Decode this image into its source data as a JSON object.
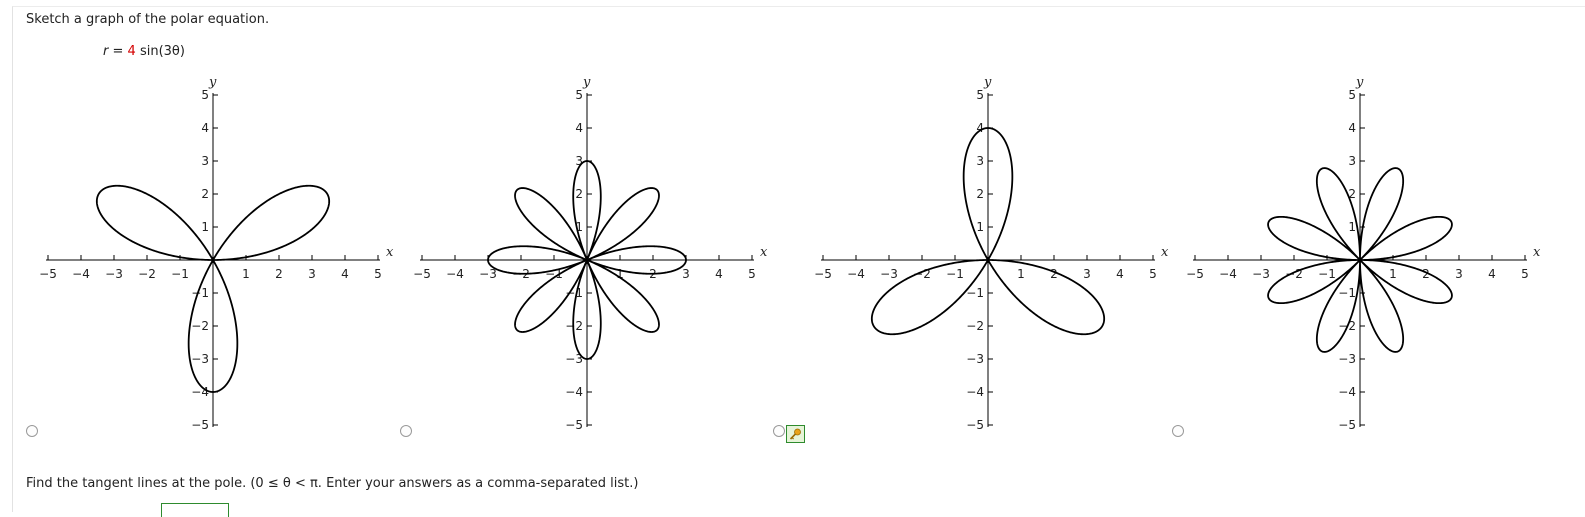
{
  "question": {
    "prompt": "Sketch a graph of the polar equation.",
    "equation": {
      "lhs": "r",
      "eq": " = ",
      "coef": "4",
      "rest": " sin(3θ)"
    },
    "coef_color": "#d40000"
  },
  "answer_options": [
    {
      "option": "A",
      "petals": 3,
      "amplitude": 4,
      "rotation": 0,
      "selected": false
    },
    {
      "option": "B",
      "petals": 8,
      "amplitude": 3,
      "rotation": 0,
      "selected": false
    },
    {
      "option": "C",
      "petals": 3,
      "amplitude": 4,
      "rotation": 180,
      "selected": false
    },
    {
      "option": "D",
      "petals": 8,
      "amplitude": 3,
      "rotation": 22.5,
      "selected": false
    }
  ],
  "chart_data": [
    {
      "type": "line",
      "option": "A",
      "series": [
        {
          "curve": "r = 4 sin(3θ)",
          "theta_range": [
            0,
            "π"
          ]
        }
      ],
      "xlabel": "x",
      "ylabel": "y",
      "xlim": [
        -5,
        5
      ],
      "ylim": [
        -5,
        5
      ],
      "ticks": [
        -5,
        -4,
        -3,
        -2,
        -1,
        1,
        2,
        3,
        4,
        5
      ],
      "grid": false
    },
    {
      "type": "line",
      "option": "B",
      "series": [
        {
          "curve": "r = 3 sin(4θ)",
          "theta_range": [
            0,
            "2π"
          ]
        }
      ],
      "xlabel": "x",
      "ylabel": "y",
      "xlim": [
        -5,
        5
      ],
      "ylim": [
        -5,
        5
      ],
      "ticks": [
        -5,
        -4,
        -3,
        -2,
        -1,
        1,
        2,
        3,
        4,
        5
      ],
      "grid": false
    },
    {
      "type": "line",
      "option": "C",
      "series": [
        {
          "curve": "r = -4 sin(3θ)",
          "theta_range": [
            0,
            "π"
          ]
        }
      ],
      "xlabel": "x",
      "ylabel": "y",
      "xlim": [
        -5,
        5
      ],
      "ylim": [
        -5,
        5
      ],
      "ticks": [
        -5,
        -4,
        -3,
        -2,
        -1,
        1,
        2,
        3,
        4,
        5
      ],
      "grid": false
    },
    {
      "type": "line",
      "option": "D",
      "series": [
        {
          "curve": "r = 3 cos(4θ), rotated 22.5°",
          "theta_range": [
            0,
            "2π"
          ]
        }
      ],
      "xlabel": "x",
      "ylabel": "y",
      "xlim": [
        -5,
        5
      ],
      "ylim": [
        -5,
        5
      ],
      "ticks": [
        -5,
        -4,
        -3,
        -2,
        -1,
        1,
        2,
        3,
        4,
        5
      ],
      "grid": false
    }
  ],
  "axes": {
    "x_label": "x",
    "y_label": "y",
    "tick_values": [
      -5,
      -4,
      -3,
      -2,
      -1,
      1,
      2,
      3,
      4,
      5
    ]
  },
  "followup": {
    "prompt": "Find the tangent lines at the pole. (0 ≤ θ < π. Enter your answers as a comma-separated list.)",
    "answer_value": ""
  },
  "icons": {
    "key_button": "key-icon"
  },
  "colors": {
    "curve": "#000000",
    "radio_border": "#9a9a9a",
    "key_button_border": "#2e8b2e",
    "key_button_fill": "#e6f4d8"
  }
}
